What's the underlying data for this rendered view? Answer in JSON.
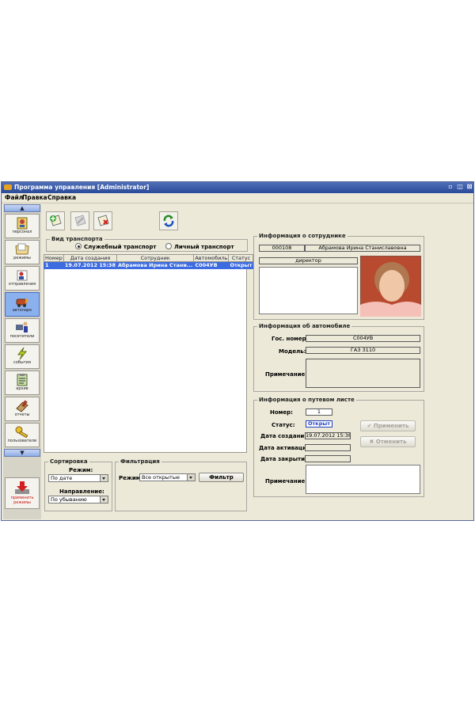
{
  "window": {
    "title": "Программа управления [Administrator]",
    "controls": [
      "minimize-icon",
      "restore-icon",
      "close-icon"
    ]
  },
  "menu": {
    "items": [
      "Файл",
      "Правка",
      "Справка"
    ]
  },
  "sidebar": {
    "items": [
      {
        "label": "персонал",
        "icon": "badge-icon"
      },
      {
        "label": "режимы",
        "icon": "folder-icon"
      },
      {
        "label": "отправления",
        "icon": "outbox-icon"
      },
      {
        "label": "автопарк",
        "icon": "car-icon",
        "active": true
      },
      {
        "label": "посетители",
        "icon": "visitor-icon"
      },
      {
        "label": "события",
        "icon": "lightning-icon"
      },
      {
        "label": "архив",
        "icon": "clipboard-icon"
      },
      {
        "label": "отчеты",
        "icon": "report-icon"
      },
      {
        "label": "пользователи",
        "icon": "key-icon"
      }
    ],
    "apply": {
      "label1": "применить",
      "label2": "режимы",
      "icon": "apply-download-icon"
    }
  },
  "transport_type": {
    "title": "Вид транспорта",
    "options": [
      "Служебный транспорт",
      "Личный транспорт"
    ],
    "selected": "Служебный транспорт"
  },
  "table": {
    "columns": [
      "Номер",
      "Дата создания",
      "Сотрудник",
      "Автомобиль",
      "Статус"
    ],
    "rows": [
      [
        "1",
        "19.07.2012 15:38",
        "Абрамова Ирина Стани...",
        "С004УВ",
        "Открыт"
      ]
    ]
  },
  "sorting": {
    "title": "Сортировка",
    "mode_label": "Режим:",
    "mode_value": "По дате",
    "direction_label": "Направление:",
    "direction_value": "По убыванию"
  },
  "filter": {
    "title": "Фильтрация",
    "mode_label": "Режим:",
    "mode_value": "Все открытые",
    "button": "Фильтр"
  },
  "employee": {
    "title": "Информация о сотруднике",
    "id": "000108",
    "name": "Абрамова Ирина Станиславовна",
    "position": "директор"
  },
  "car": {
    "title": "Информация об автомобиле",
    "plate_label": "Гос. номер:",
    "plate": "С004УВ",
    "model_label": "Модель:",
    "model": "ГАЗ 3110",
    "note_label": "Примечание:"
  },
  "waybill": {
    "title": "Информация о путевом листе",
    "number_label": "Номер:",
    "number": "1",
    "status_label": "Статус:",
    "status": "Открыт",
    "created_label": "Дата создания:",
    "created": "19.07.2012 15:38",
    "activated_label": "Дата активации:",
    "closed_label": "Дата закрытия:",
    "note_label": "Примечание:",
    "apply_button": "Применить",
    "cancel_button": "Отменить"
  },
  "colors": {
    "accent": "#3d6be0",
    "titlebar": "#3a5aa8",
    "panel": "#ece9d8"
  }
}
